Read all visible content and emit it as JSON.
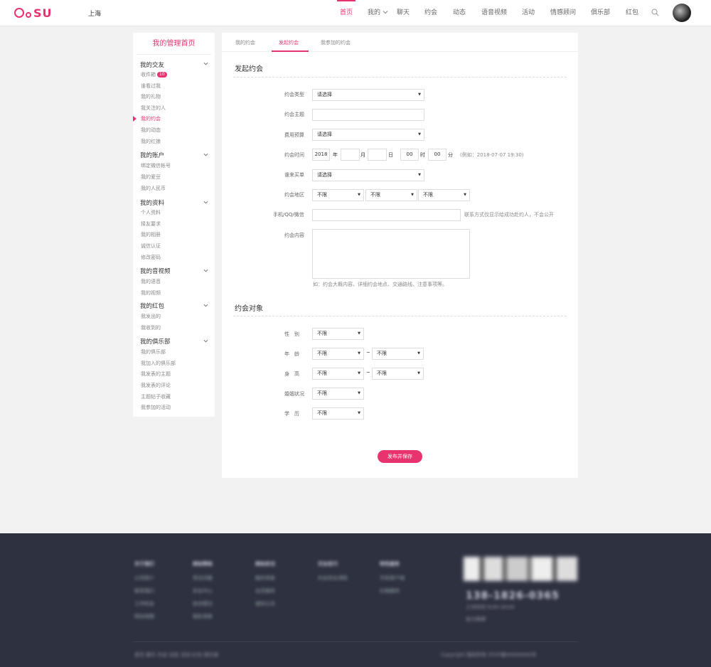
{
  "header": {
    "logo_text": "SU",
    "city": "上海",
    "nav": [
      {
        "label": "首页",
        "active": true
      },
      {
        "label": "我的"
      },
      {
        "label": "聊天"
      },
      {
        "label": "约会"
      },
      {
        "label": "动态"
      },
      {
        "label": "语音视频"
      },
      {
        "label": "活动"
      },
      {
        "label": "情感顾问"
      },
      {
        "label": "俱乐部"
      },
      {
        "label": "红包"
      }
    ]
  },
  "sidebar": {
    "title": "我的管理首页",
    "groups": [
      {
        "label": "我的交友",
        "items": [
          {
            "label": "收件箱",
            "badge": "10"
          },
          {
            "label": "谁看过我"
          },
          {
            "label": "我的礼物"
          },
          {
            "label": "我关注的人"
          },
          {
            "label": "我的约会",
            "active": true
          },
          {
            "label": "我的动态"
          },
          {
            "label": "我的红娘"
          }
        ]
      },
      {
        "label": "我的账户",
        "items": [
          {
            "label": "绑定微信帐号"
          },
          {
            "label": "我的爱豆"
          },
          {
            "label": "我的人民币"
          }
        ]
      },
      {
        "label": "我的资料",
        "items": [
          {
            "label": "个人资料"
          },
          {
            "label": "择友要求"
          },
          {
            "label": "我的相册"
          },
          {
            "label": "诚信认证"
          },
          {
            "label": "修改密码"
          }
        ]
      },
      {
        "label": "我的音视频",
        "items": [
          {
            "label": "我的语音"
          },
          {
            "label": "我的视频"
          }
        ]
      },
      {
        "label": "我的红包",
        "items": [
          {
            "label": "我发出的"
          },
          {
            "label": "我收到的"
          }
        ]
      },
      {
        "label": "我的俱乐部",
        "items": [
          {
            "label": "我的俱乐部"
          },
          {
            "label": "我加入的俱乐部"
          },
          {
            "label": "我发表的主题"
          },
          {
            "label": "我发表的评论"
          },
          {
            "label": "主题帖子收藏"
          },
          {
            "label": "我参加的活动"
          }
        ]
      }
    ]
  },
  "tabs": [
    {
      "label": "我的约会"
    },
    {
      "label": "发起约会",
      "active": true
    },
    {
      "label": "我参加的约会"
    }
  ],
  "form": {
    "section1_title": "发起约会",
    "type_label": "约会类型",
    "type_value": "请选择",
    "topic_label": "约会主题",
    "topic_value": "",
    "budget_label": "费用预算",
    "budget_value": "请选择",
    "time_label": "约会时间",
    "time_year": "2018",
    "time_year_unit": "年",
    "time_month": "",
    "time_month_unit": "月",
    "time_day": "",
    "time_day_unit": "日",
    "time_hour": "00",
    "time_hour_unit": "时",
    "time_minute": "00",
    "time_minute_unit": "分",
    "time_example": "(例如：2018-07-07 19:30)",
    "payer_label": "谁来买单",
    "payer_value": "请选择",
    "area_label": "约会地区",
    "area_values": [
      "不限",
      "不限",
      "不限"
    ],
    "contact_label": "手机/QQ/微信",
    "contact_value": "",
    "contact_hint": "联系方式仅显示给成功赴约人，不会公开",
    "content_label": "约会内容",
    "content_hint": "如：约会大概内容、详细约会地点、交通路线、注意事项等。",
    "section2_title": "约会对象",
    "gender_label": "性　别",
    "gender_value": "不限",
    "age_label": "年　龄",
    "age_from": "不限",
    "age_to": "不限",
    "height_label": "身　高",
    "height_from": "不限",
    "height_to": "不限",
    "range_sep": "~",
    "marital_label": "婚姻状况",
    "marital_value": "不限",
    "education_label": "学　历",
    "education_value": "不限",
    "submit_label": "发布并保存"
  },
  "footer": {
    "cols": [
      {
        "head": "关于我们",
        "items": [
          "公司简介",
          "联系我们",
          "工作机会",
          "网站地图"
        ]
      },
      {
        "head": "网站帮助",
        "items": [
          "常见问题",
          "安全中心",
          "投诉建议",
          "隐私条款"
        ]
      },
      {
        "head": "网站状况",
        "items": [
          "服务条款",
          "会员服务",
          "诚信认证"
        ]
      },
      {
        "head": "交友技巧",
        "items": [
          "约会安全须知"
        ]
      },
      {
        "head": "特色服务",
        "items": [
          "手机客户端",
          "红娘服务"
        ]
      }
    ],
    "phone": "138-1826-0365",
    "sub": "工作时间 9:00-18:00",
    "weibo": "官方微博",
    "links": "首页  聊天  约会  动态  活动  红包  俱乐部",
    "copyright": "Copyright 版权所有   沪ICP备00000000号"
  },
  "colors": {
    "accent": "#e8336e",
    "footer_bg": "#2e3140"
  }
}
